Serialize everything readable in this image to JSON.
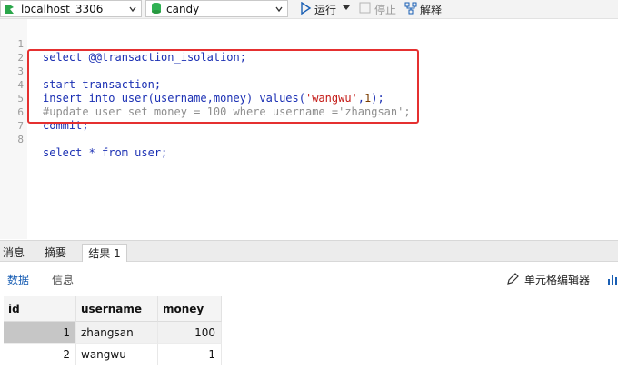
{
  "toolbar": {
    "connection": "localhost_3306",
    "database": "candy",
    "run_label": "运行",
    "stop_label": "停止",
    "explain_label": "解释"
  },
  "editor": {
    "lines": [
      {
        "no": "1",
        "text": "select @@transaction_isolation;"
      },
      {
        "no": "2",
        "text": ""
      },
      {
        "no": "3",
        "text": "start transaction;"
      },
      {
        "no": "4",
        "pre": "insert into user(username,money) values(",
        "str": "'wangwu'",
        "mid": ",",
        "num": "1",
        "post": ");"
      },
      {
        "no": "5",
        "comment": "#update user set money = 100 where username ='zhangsan';"
      },
      {
        "no": "6",
        "text": "commit;"
      },
      {
        "no": "7",
        "text": ""
      },
      {
        "no": "8",
        "text": "select * from user;"
      }
    ]
  },
  "result_tabs": [
    "消息",
    "摘要",
    "结果 1"
  ],
  "sub_tabs": {
    "data": "数据",
    "info": "信息"
  },
  "cell_editor_label": "单元格编辑器",
  "table": {
    "columns": [
      "id",
      "username",
      "money"
    ],
    "rows": [
      {
        "id": "1",
        "username": "zhangsan",
        "money": "100"
      },
      {
        "id": "2",
        "username": "wangwu",
        "money": "1"
      }
    ]
  },
  "colors": {
    "accent": "#1a5fb4",
    "highlight_border": "#e53030"
  }
}
